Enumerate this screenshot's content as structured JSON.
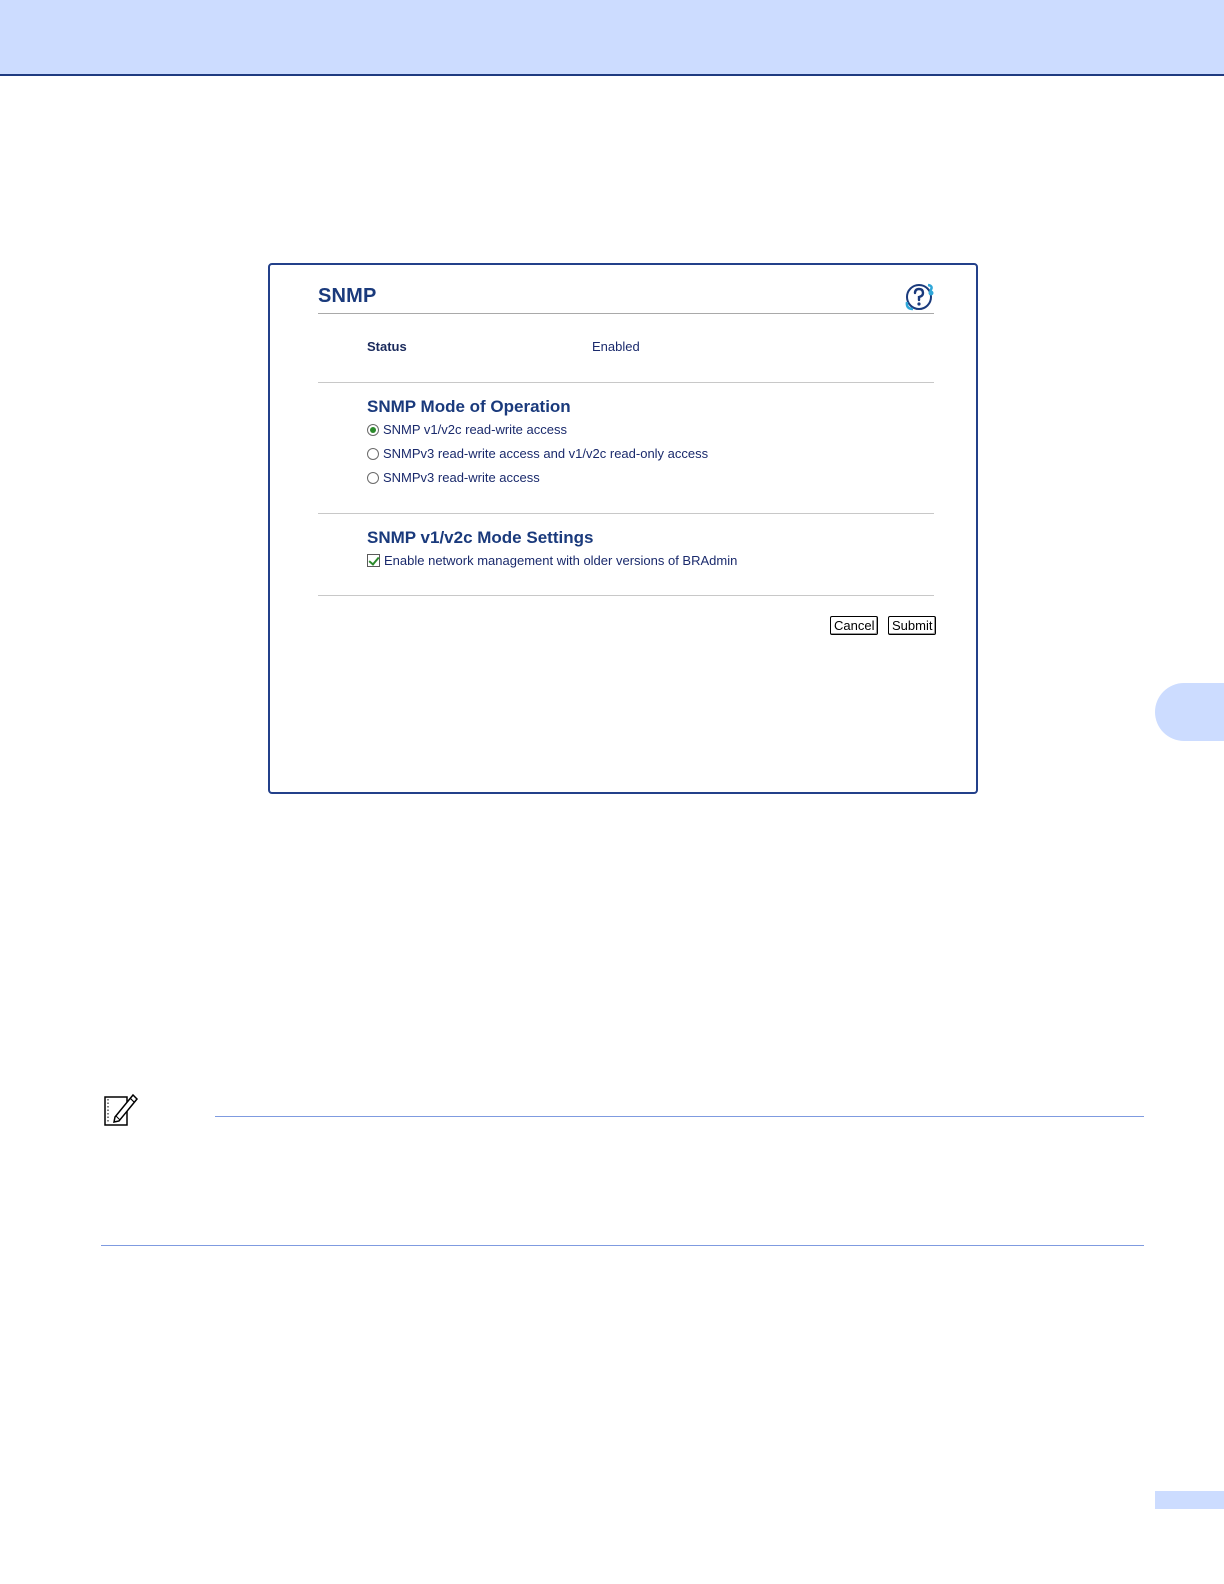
{
  "snmp_panel": {
    "title": "SNMP",
    "help_icon": "help-question-icon",
    "status": {
      "label": "Status",
      "value": "Enabled"
    },
    "mode_section": {
      "heading": "SNMP Mode of Operation",
      "options": [
        {
          "label": "SNMP v1/v2c read-write access",
          "selected": true
        },
        {
          "label": "SNMPv3 read-write access and v1/v2c read-only access",
          "selected": false
        },
        {
          "label": "SNMPv3 read-write access",
          "selected": false
        }
      ]
    },
    "v1v2c_section": {
      "heading": "SNMP v1/v2c Mode Settings",
      "checkbox_label": "Enable network management with older versions of BRAdmin",
      "checked": true
    },
    "buttons": {
      "cancel": "Cancel",
      "submit": "Submit"
    }
  },
  "note": {
    "icon": "note-pencil-icon"
  },
  "colors": {
    "header_band": "#ccdcff",
    "header_border": "#1f3b80",
    "heading_text": "#1a3a7c",
    "note_rule": "#7f9be0",
    "selected_green": "#2b8a2b"
  }
}
